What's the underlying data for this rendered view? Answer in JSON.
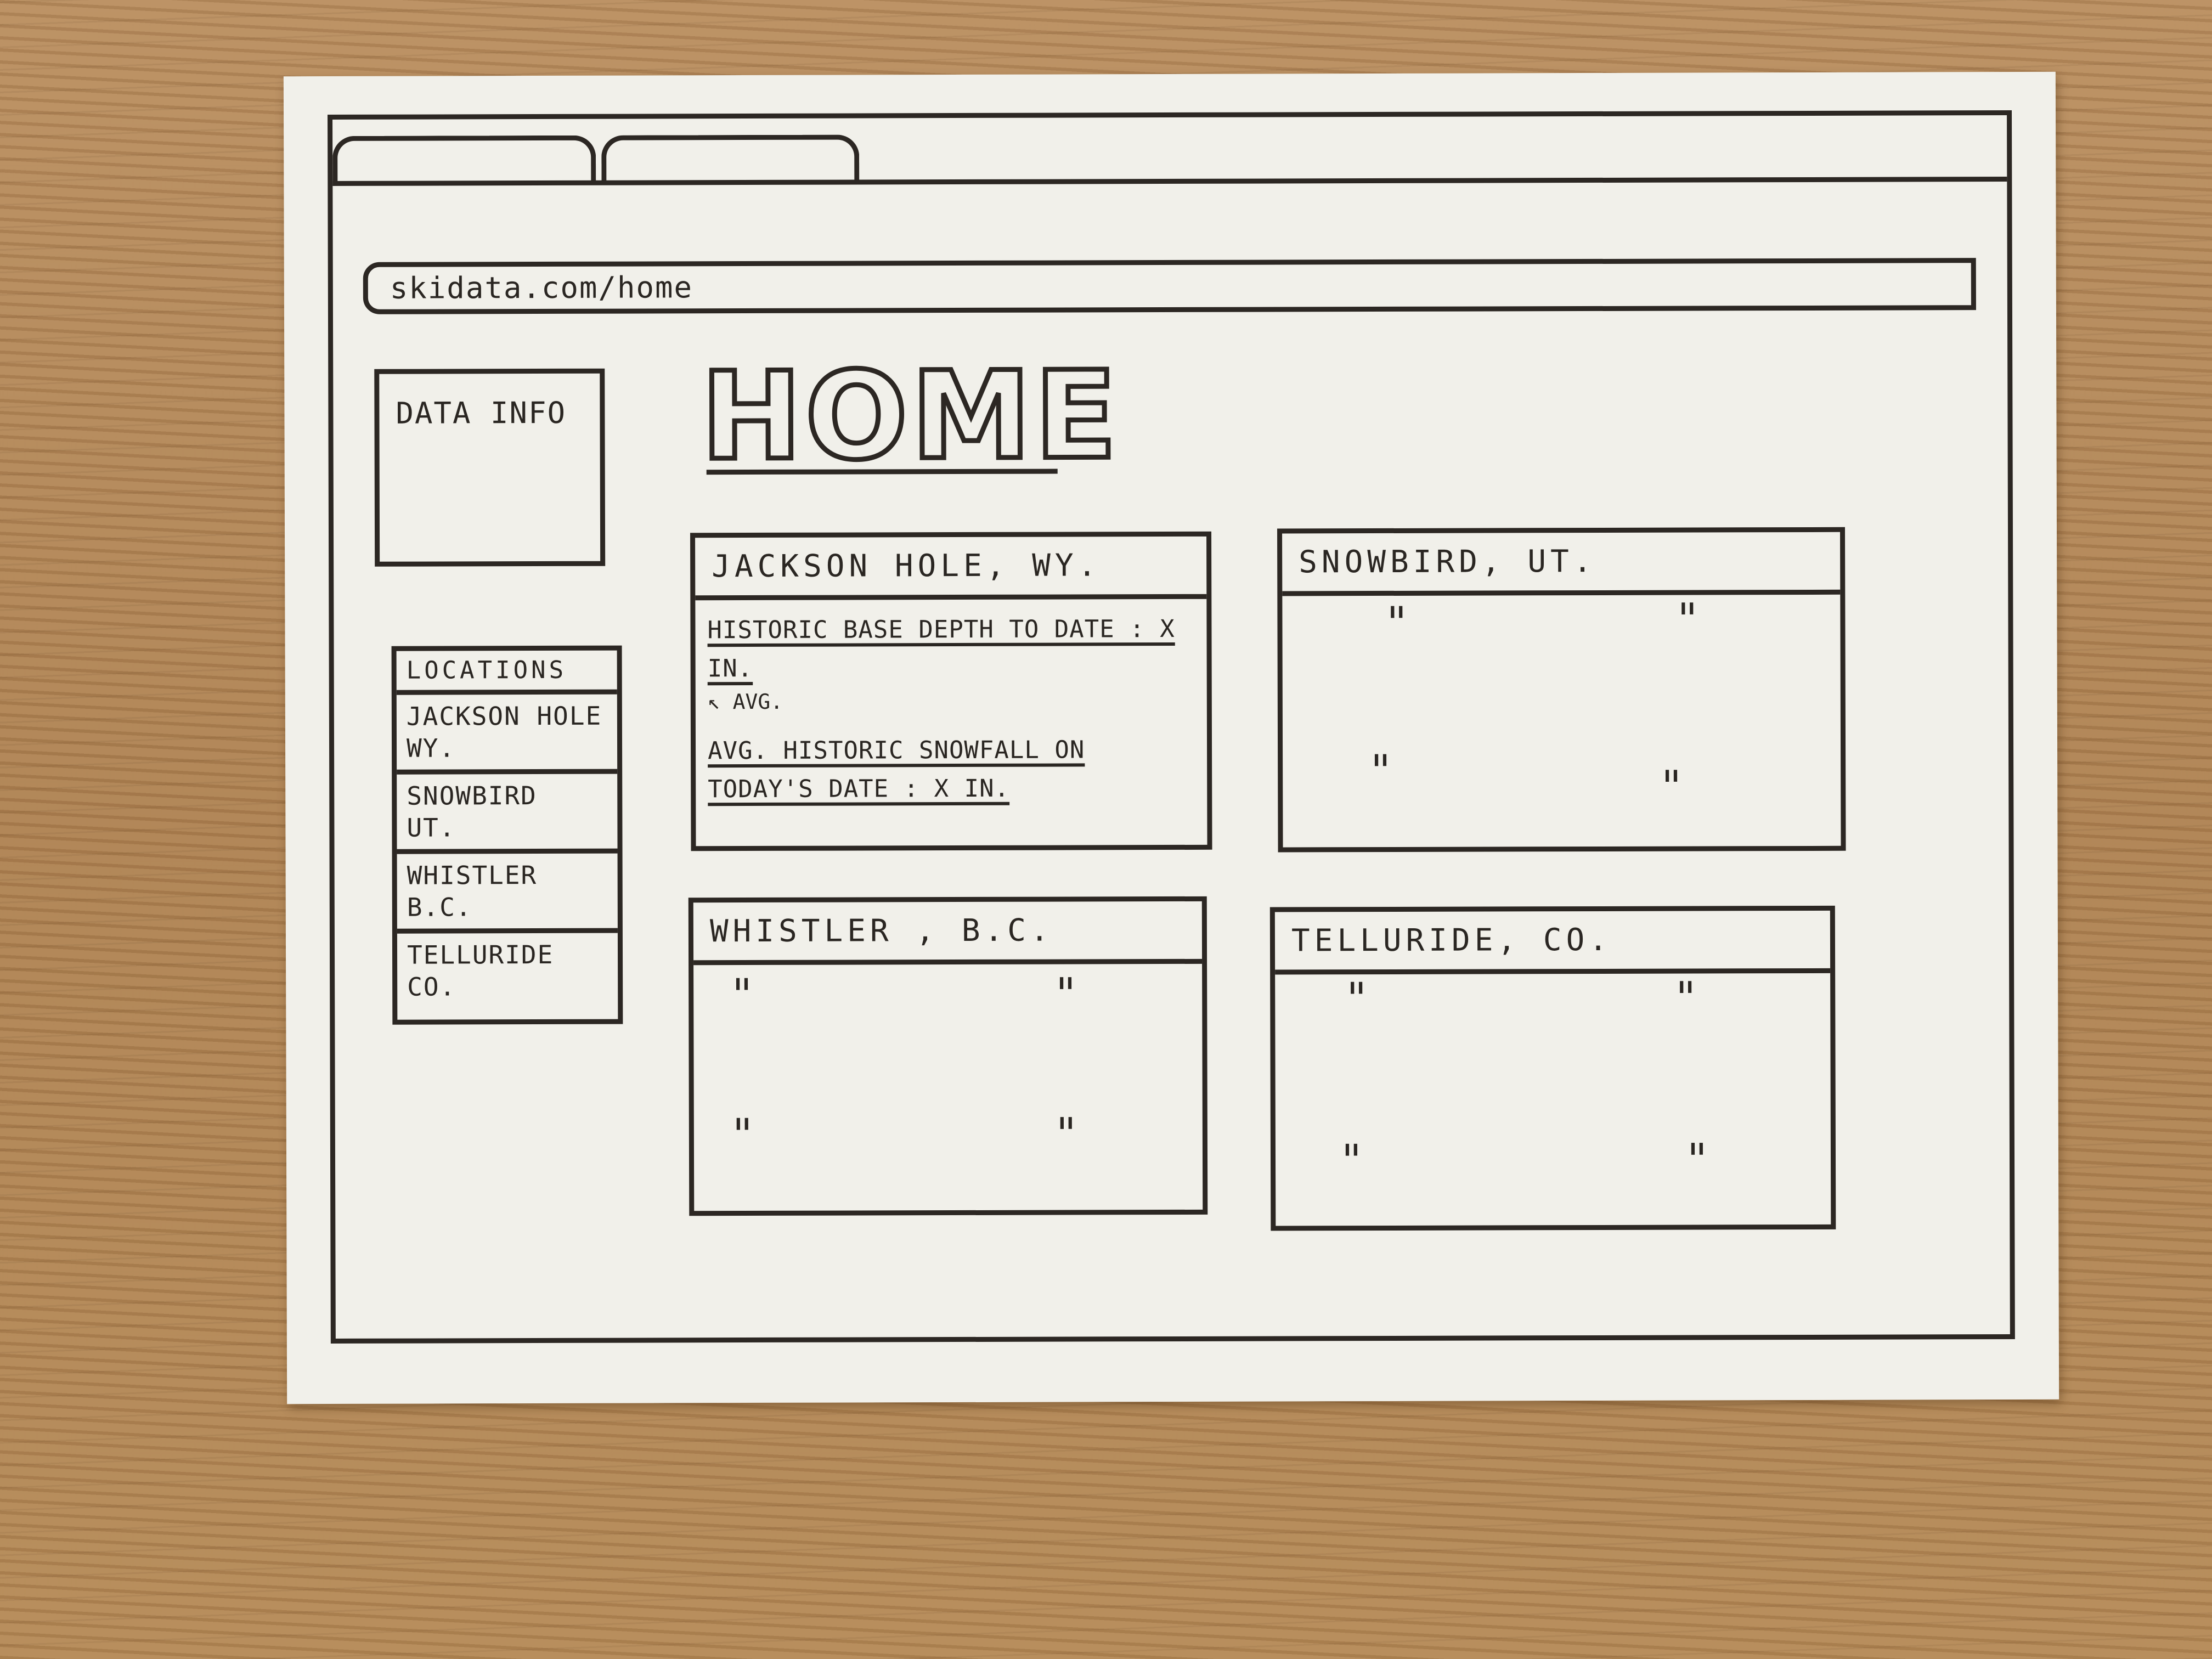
{
  "browser": {
    "url": "skidata.com/home"
  },
  "sidebar": {
    "data_info_label": "DATA INFO",
    "locations_header": "LOCATIONS",
    "locations": [
      "JACKSON HOLE\nWY.",
      "SNOWBIRD\nUT.",
      "WHISTLER\nB.C.",
      "TELLURIDE\nCO."
    ]
  },
  "main": {
    "title": "HOME",
    "cards": [
      {
        "title": "JACKSON HOLE, WY.",
        "base_depth_label": "HISTORIC BASE DEPTH TO DATE : X IN.",
        "base_depth_note": "↖ AVG.",
        "snowfall_label_1": "AVG. HISTORIC SNOWFALL ON",
        "snowfall_label_2": "TODAY'S DATE : X IN."
      },
      {
        "title": "SNOWBIRD, UT.",
        "ditto": "\""
      },
      {
        "title": "WHISTLER , B.C.",
        "ditto": "\""
      },
      {
        "title": "TELLURIDE, CO.",
        "ditto": "\""
      }
    ]
  }
}
